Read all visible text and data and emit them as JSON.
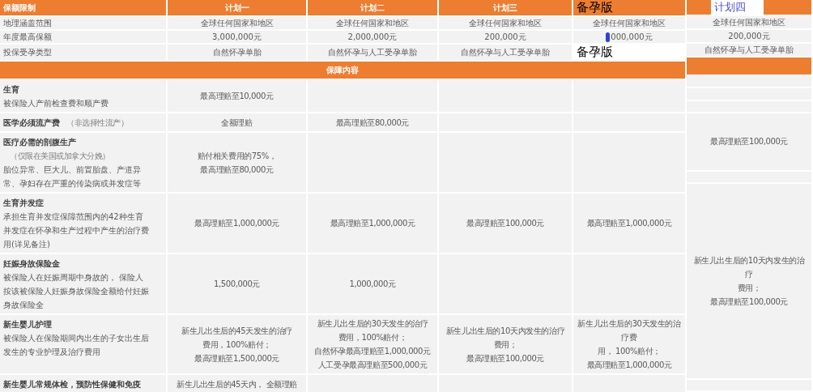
{
  "main_table": {
    "corner_label": "保额限制",
    "plans": [
      {
        "kind": "plan",
        "text": "计划一"
      },
      {
        "kind": "plan",
        "text": "计划二"
      },
      {
        "kind": "plan",
        "text": "计划三"
      },
      {
        "kind": "stamp",
        "text": "备孕版"
      }
    ],
    "limit_rows": [
      {
        "label": "地理涵盖范围",
        "cells": [
          {
            "kind": "text",
            "text": "全球任何国家和地区"
          },
          {
            "kind": "text",
            "text": "全球任何国家和地区"
          },
          {
            "kind": "text",
            "text": "全球任何国家和地区"
          },
          {
            "kind": "text",
            "text": "全球任何国家和地区"
          }
        ]
      },
      {
        "label": "年度最高保额",
        "cells": [
          {
            "kind": "text",
            "text": "3,000,000元"
          },
          {
            "kind": "text",
            "text": "2,000,000元"
          },
          {
            "kind": "text",
            "text": "200,000元"
          },
          {
            "kind": "masked",
            "text": "000,000元"
          }
        ]
      },
      {
        "label": "投保受孕类型",
        "cells": [
          {
            "kind": "text",
            "text": "自然怀孕单胎"
          },
          {
            "kind": "text",
            "text": "自然怀孕与人工受孕单胎"
          },
          {
            "kind": "text",
            "text": "自然怀孕与人工受孕单胎"
          },
          {
            "kind": "stamp",
            "text": "备孕版"
          }
        ]
      }
    ],
    "section_header": "保障内容",
    "benefit_rows": [
      {
        "title": "生育",
        "description": "被保险人产前检查费和顺产费",
        "cells": [
          [
            "最高理赔至10,000元"
          ],
          null,
          null,
          null
        ]
      },
      {
        "title": "医学必须流产费",
        "note": "（非选择性流产）",
        "cells": [
          [
            "全额理赔"
          ],
          [
            "最高理赔至80,000元"
          ],
          null,
          null
        ]
      },
      {
        "title": "医疗必需的剖腹生产",
        "note": "（仅限在美国或加拿大分娩）",
        "description": "胎位异常、巨大儿、前置胎盘、产道异常、孕妇存在严重的传染病或并发症等",
        "cells": [
          [
            "赔付相关费用的75%，",
            "最高理赔至80,000元"
          ],
          null,
          null,
          null
        ]
      },
      {
        "title": "生育并发症",
        "description": "承担生育并发症保障范围内的42种生育并发症在怀孕和生产过程中产生的治疗费用(详见备注)",
        "cells": [
          [
            "最高理赔至1,000,000元"
          ],
          [
            "最高理赔至1,000,000元"
          ],
          [
            "最高理赔至100,000元"
          ],
          [
            "最高理赔至1,000,000元"
          ]
        ]
      },
      {
        "title": "妊娠身故保险金",
        "description": "被保险人在妊娠周期中身故的，  保险人按该被保险人妊娠身故保险全额给付妊娠身故保险全",
        "cells": [
          [
            "1,500,000元"
          ],
          [
            "1,000,000元"
          ],
          null,
          null
        ]
      },
      {
        "title": "新生婴儿护理",
        "description": "被保险人在保险期间内出生的子女出生后发生的专业护理及治疗费用",
        "cells": [
          [
            "新生儿出生后的45天发生的治疗",
            "费用，100%赔付；",
            "最高理赔至1,500,000元"
          ],
          [
            "新生儿出生后的30天发生的治疗",
            "费用，100%赔付；",
            "自然怀孕最高理赔至1,000,000元",
            "人工受孕最高理赔至500,000元"
          ],
          [
            "新生儿出生后的10天内发生的治疗",
            "费用；",
            "最高理赔至100,000元"
          ],
          [
            "新生儿出生后的30天发生的治疗费",
            "用，  100%赔付；",
            "最高理赔至1,000,000元"
          ]
        ]
      },
      {
        "title": "新生婴儿常规体检，预防性保健和免疫",
        "cells": [
          [
            "新生儿出生后的45天内，  全额理赔"
          ],
          null,
          null,
          null
        ]
      }
    ]
  },
  "side_table": {
    "header": "计划四",
    "limit_cells": [
      "全球任何国家和地区",
      "200,000元",
      "自然怀孕与人工受孕单胎"
    ],
    "benefit_cells": [
      null,
      null,
      null,
      [
        "最高理赔至100,000元"
      ],
      null,
      [
        "新生儿出生后的10天内发生的治疗",
        "费用；",
        "最高理赔至100,000元"
      ],
      null
    ]
  }
}
